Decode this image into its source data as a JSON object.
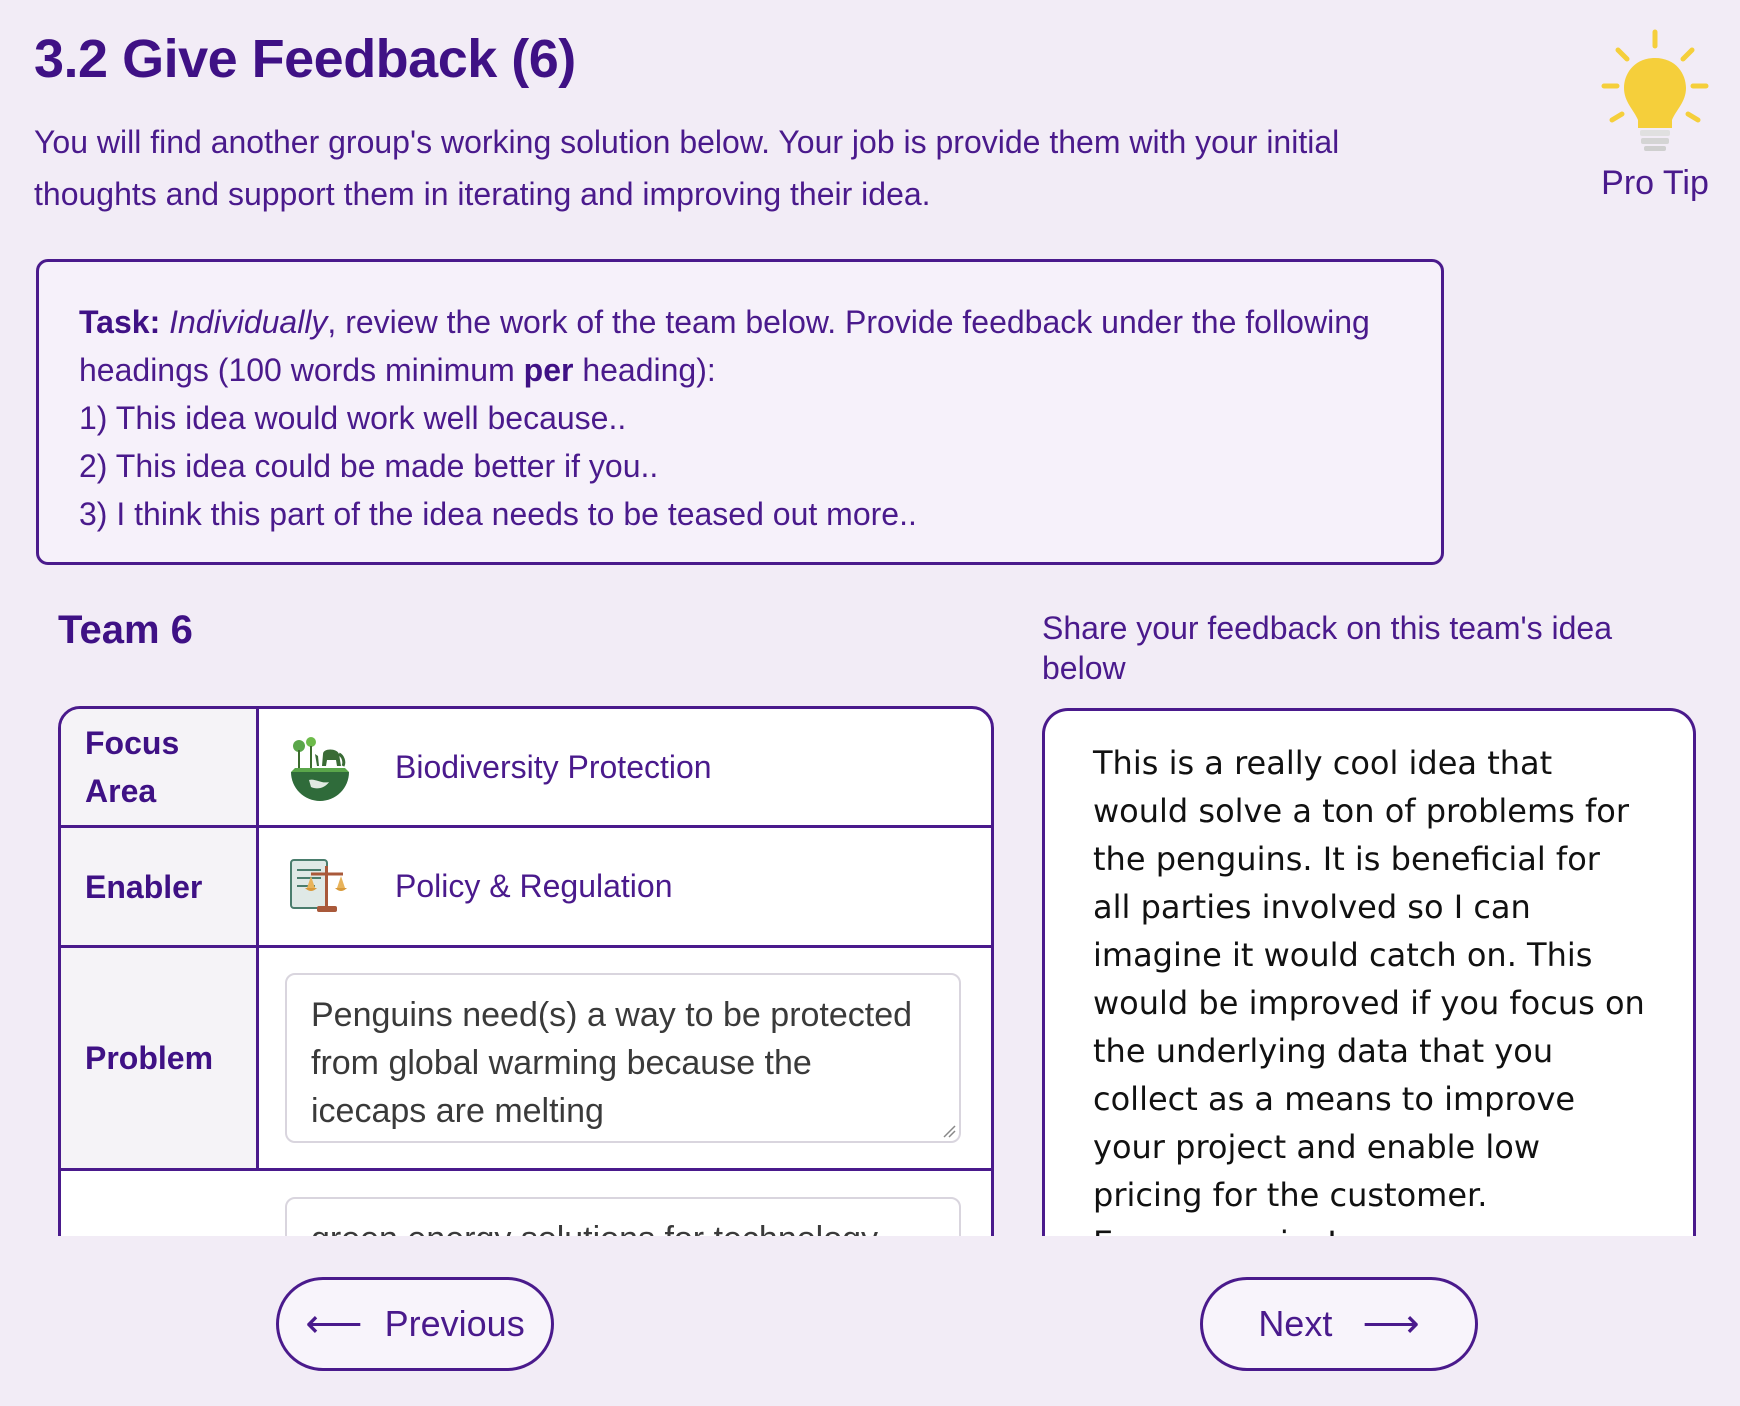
{
  "header": {
    "title": "3.2 Give Feedback (6)",
    "intro": "You will find another group's working solution below. Your job is provide them with your initial thoughts and support them in iterating and improving their idea."
  },
  "pro_tip": {
    "label": "Pro Tip",
    "icon": "lightbulb-icon"
  },
  "task": {
    "label": "Task:",
    "emphasis": "Individually",
    "text_1": ", review the work of the team below. Provide feedback under the following headings (100 words minimum ",
    "bold_word": "per",
    "text_2": " heading):",
    "items": [
      "1) This idea would work well because..",
      "2) This idea could be made better if you..",
      "3) I think this part of the idea needs to be teased out more.."
    ]
  },
  "team": {
    "title": "Team 6",
    "rows": [
      {
        "label": "Focus Area",
        "value": "Biodiversity Protection",
        "icon": "biodiversity-icon"
      },
      {
        "label": "Enabler",
        "value": "Policy & Regulation",
        "icon": "policy-icon"
      },
      {
        "label": "Problem",
        "value": "Penguins need(s) a way to be protected from global warming because the icecaps are melting"
      },
      {
        "label": "",
        "value": "green energy solutions for technology"
      }
    ]
  },
  "feedback": {
    "label": "Share your feedback on this team's idea below",
    "text": "This is a really cool idea that would solve a ton of problems for the penguins. It is beneficial for all parties involved so I can imagine it would catch on. This would be improved if you focus on the underlying data that you collect as a means to improve your project and enable low pricing for the customer. Everyone wins!"
  },
  "nav": {
    "previous_label": "Previous",
    "next_label": "Next"
  },
  "colors": {
    "accent": "#4a1a8c",
    "background": "#f2ecf6",
    "bulb": "#f5cf3b"
  }
}
